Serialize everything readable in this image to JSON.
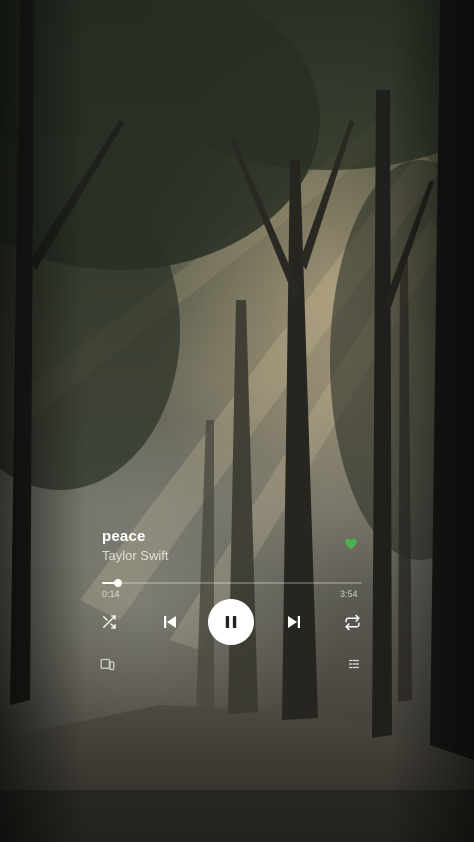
{
  "track": {
    "title": "peace",
    "artist": "Taylor Swift",
    "liked": true
  },
  "playback": {
    "elapsed": "0:14",
    "duration": "3:54",
    "progress": 0.06,
    "state": "playing"
  },
  "controls": {
    "shuffle_icon": "shuffle-icon",
    "previous_icon": "skip-previous-icon",
    "play_pause_icon": "pause-icon",
    "next_icon": "skip-next-icon",
    "repeat_icon": "repeat-icon",
    "devices_icon": "devices-icon",
    "queue_icon": "queue-icon"
  },
  "colors": {
    "like": "#4caf50",
    "foreground": "#ffffff",
    "play_button": "#ffffff"
  }
}
